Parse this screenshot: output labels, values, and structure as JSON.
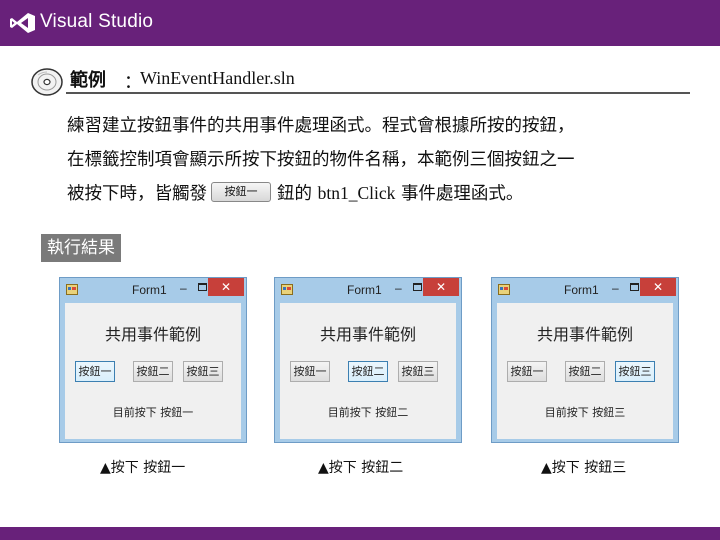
{
  "header": {
    "app_title": "Visual Studio"
  },
  "example": {
    "label": "範例",
    "colon": "：",
    "filename": "Win​EventHandler.sln"
  },
  "paragraph": {
    "line1": "練習建立按鈕事件的共用事件處理函式。程式會根據所按的按鈕，",
    "line2": "在標籤控制項會顯示所按下按鈕的物件名稱，本範例三個按鈕之一",
    "line3_before": "被按下時，皆觸發",
    "inline_button_label": "按鈕一",
    "line3_middle": "鈕的",
    "line3_code": "btn1_Click",
    "line3_after": "事件處理函式。"
  },
  "result_label": "執行結果",
  "windows": [
    {
      "title": "Form1",
      "min": "–",
      "close": "✕",
      "heading": "共用事件範例",
      "buttons": [
        "按鈕一",
        "按鈕二",
        "按鈕三"
      ],
      "focused_index": 0,
      "status": "目前按下 按鈕一",
      "caption": "▲按下 按鈕一"
    },
    {
      "title": "Form1",
      "min": "–",
      "close": "✕",
      "heading": "共用事件範例",
      "buttons": [
        "按鈕一",
        "按鈕二",
        "按鈕三"
      ],
      "focused_index": 1,
      "status": "目前按下 按鈕二",
      "caption": "▲按下 按鈕二"
    },
    {
      "title": "Form1",
      "min": "–",
      "close": "✕",
      "heading": "共用事件範例",
      "buttons": [
        "按鈕一",
        "按鈕二",
        "按鈕三"
      ],
      "focused_index": 2,
      "status": "目前按下 按鈕三",
      "caption": "▲按下 按鈕三"
    }
  ],
  "colors": {
    "brand": "#68217a",
    "close_button": "#c7403a",
    "window_border": "#a7cbe8"
  }
}
